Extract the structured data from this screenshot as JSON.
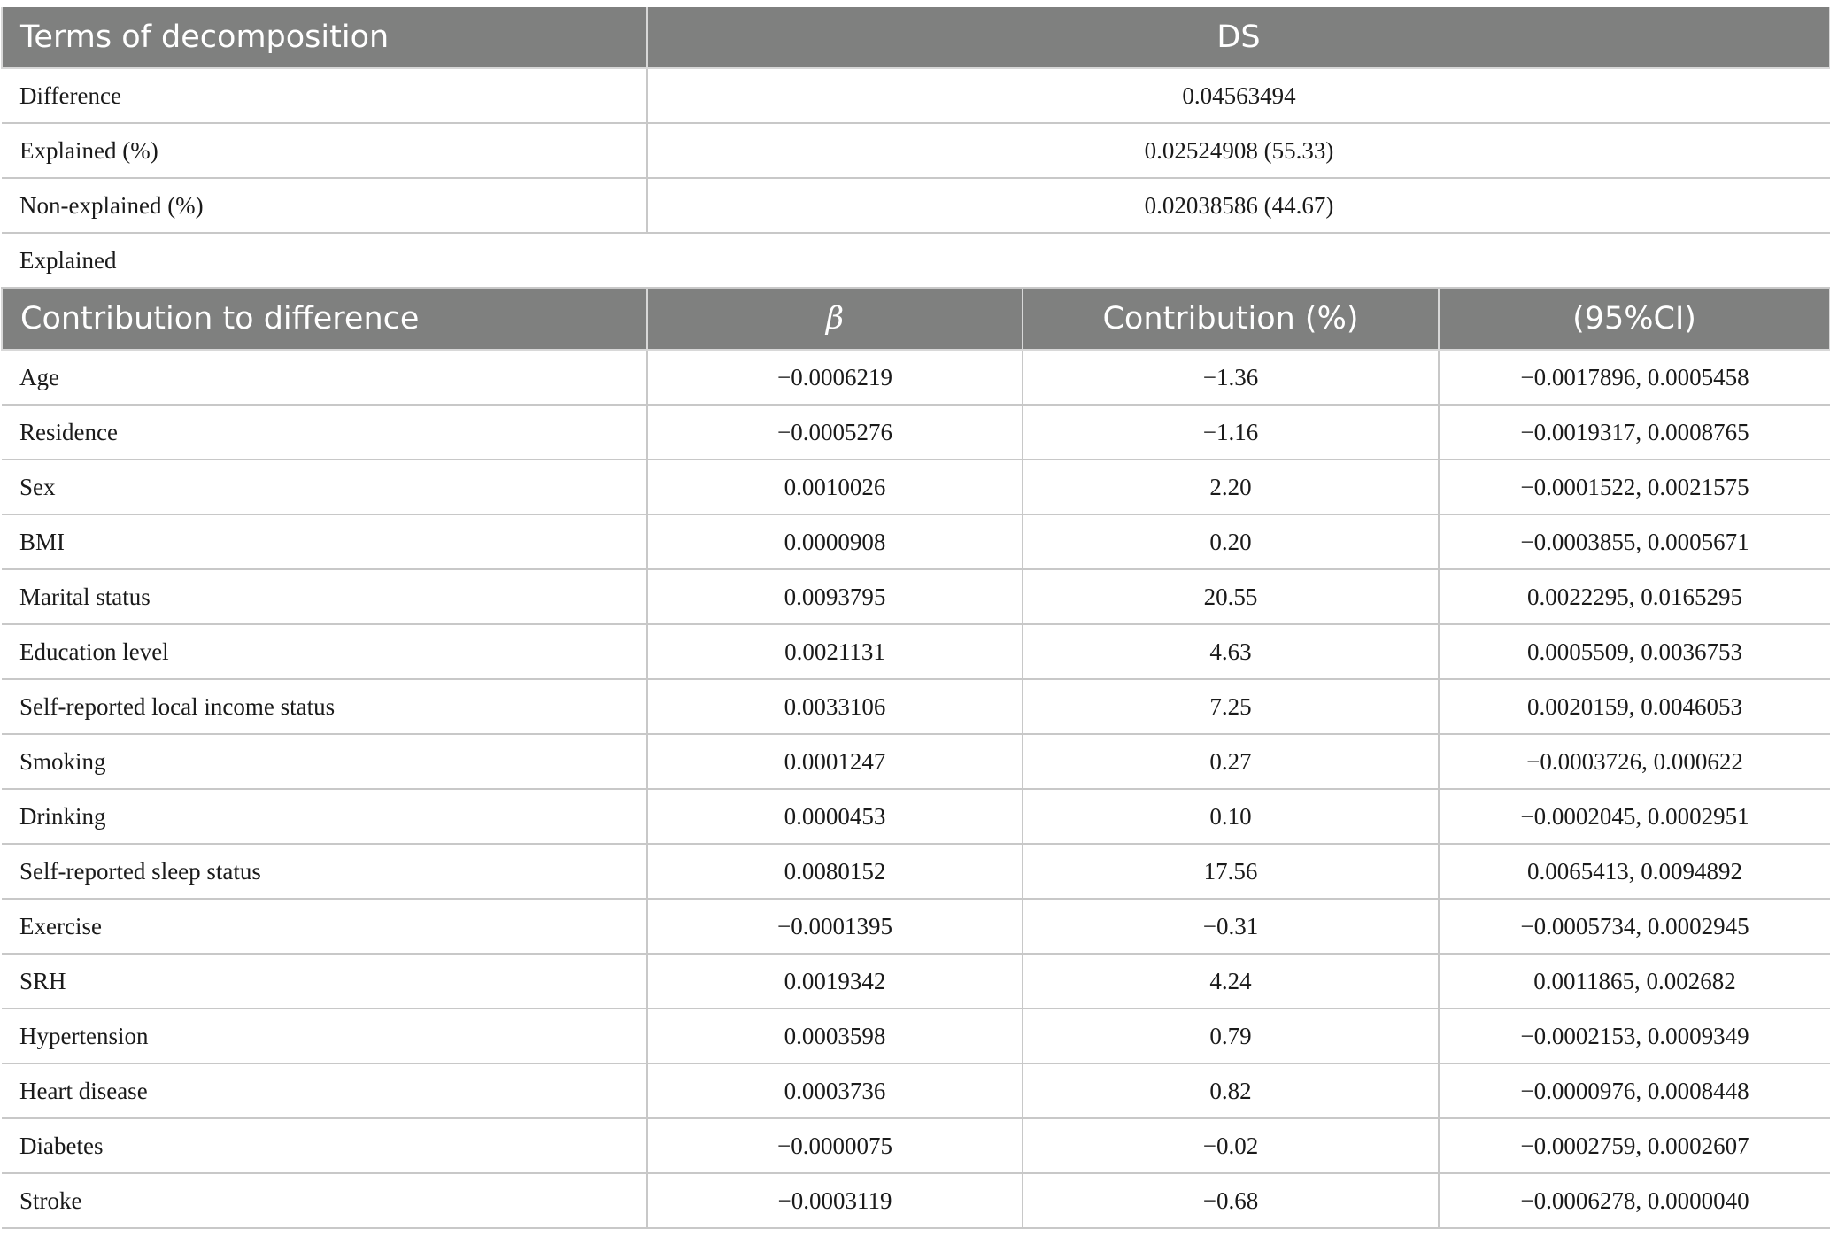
{
  "summary": {
    "header": {
      "term": "Terms of decomposition",
      "value": "DS"
    },
    "rows": [
      {
        "label": "Difference",
        "value": "0.04563494"
      },
      {
        "label": "Explained (%)",
        "value": "0.02524908 (55.33)"
      },
      {
        "label": "Non-explained (%)",
        "value": "0.02038586 (44.67)"
      }
    ],
    "section_label": "Explained"
  },
  "contrib": {
    "header": {
      "factor": "Contribution to difference",
      "beta": "β",
      "contribution": "Contribution (%)",
      "ci": "(95%CI)"
    },
    "rows": [
      {
        "factor": "Age",
        "beta": "−0.0006219",
        "contribution": "−1.36",
        "ci": "−0.0017896, 0.0005458"
      },
      {
        "factor": "Residence",
        "beta": "−0.0005276",
        "contribution": "−1.16",
        "ci": "−0.0019317, 0.0008765"
      },
      {
        "factor": "Sex",
        "beta": "0.0010026",
        "contribution": "2.20",
        "ci": "−0.0001522, 0.0021575"
      },
      {
        "factor": "BMI",
        "beta": "0.0000908",
        "contribution": "0.20",
        "ci": "−0.0003855, 0.0005671"
      },
      {
        "factor": "Marital status",
        "beta": "0.0093795",
        "contribution": "20.55",
        "ci": "0.0022295, 0.0165295"
      },
      {
        "factor": "Education level",
        "beta": "0.0021131",
        "contribution": "4.63",
        "ci": "0.0005509, 0.0036753"
      },
      {
        "factor": "Self-reported local income status",
        "beta": "0.0033106",
        "contribution": "7.25",
        "ci": "0.0020159, 0.0046053"
      },
      {
        "factor": "Smoking",
        "beta": "0.0001247",
        "contribution": "0.27",
        "ci": "−0.0003726, 0.000622"
      },
      {
        "factor": "Drinking",
        "beta": "0.0000453",
        "contribution": "0.10",
        "ci": "−0.0002045, 0.0002951"
      },
      {
        "factor": "Self-reported sleep status",
        "beta": "0.0080152",
        "contribution": "17.56",
        "ci": "0.0065413, 0.0094892"
      },
      {
        "factor": "Exercise",
        "beta": "−0.0001395",
        "contribution": "−0.31",
        "ci": "−0.0005734, 0.0002945"
      },
      {
        "factor": "SRH",
        "beta": "0.0019342",
        "contribution": "4.24",
        "ci": "0.0011865, 0.002682"
      },
      {
        "factor": "Hypertension",
        "beta": "0.0003598",
        "contribution": "0.79",
        "ci": "−0.0002153, 0.0009349"
      },
      {
        "factor": "Heart disease",
        "beta": "0.0003736",
        "contribution": "0.82",
        "ci": "−0.0000976, 0.0008448"
      },
      {
        "factor": "Diabetes",
        "beta": "−0.0000075",
        "contribution": "−0.02",
        "ci": "−0.0002759, 0.0002607"
      },
      {
        "factor": "Stroke",
        "beta": "−0.0003119",
        "contribution": "−0.68",
        "ci": "−0.0006278, 0.0000040"
      }
    ]
  }
}
